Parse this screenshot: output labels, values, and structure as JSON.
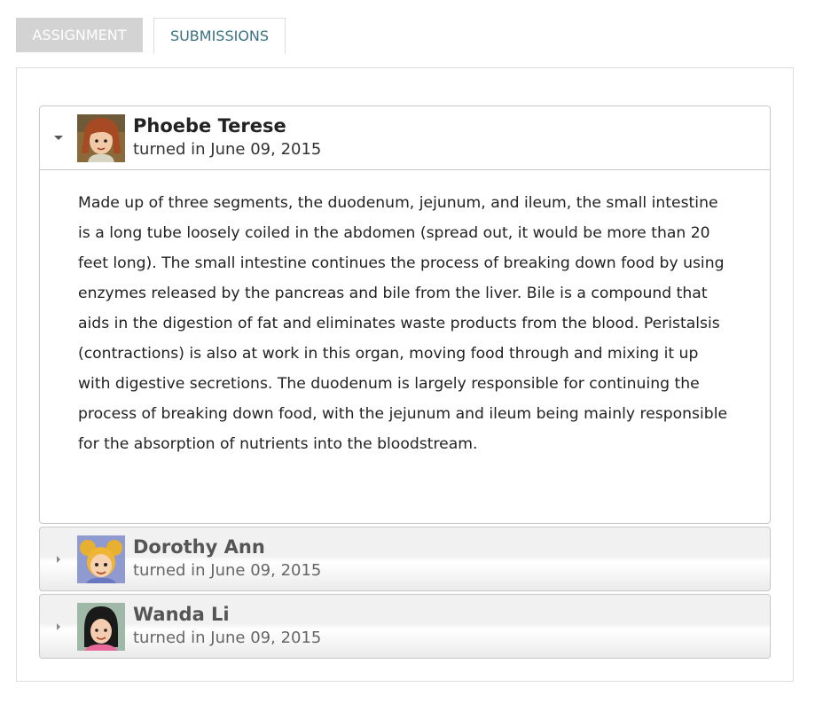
{
  "tabs": {
    "assignment": "ASSIGNMENT",
    "submissions": "SUBMISSIONS"
  },
  "submissions": [
    {
      "name": "Phoebe Terese",
      "meta": "turned in June 09, 2015",
      "expanded": true,
      "text": "Made up of three segments, the duodenum, jejunum, and ileum, the small intestine is a long tube loosely coiled in the abdomen (spread out, it would be more than 20 feet long). The small intestine continues the process of breaking down food by using enzymes released by the pancreas and bile from the liver. Bile is a compound that aids in the digestion of fat and eliminates waste products from the blood. Peristalsis (contractions) is also at work in this organ, moving food through and mixing it up with digestive secretions. The duodenum is largely responsible for continuing the process of breaking down food, with the jejunum and ileum being mainly responsible for the absorption of nutrients into the bloodstream."
    },
    {
      "name": "Dorothy Ann",
      "meta": "turned in June 09, 2015",
      "expanded": false
    },
    {
      "name": "Wanda Li",
      "meta": "turned in June 09, 2015",
      "expanded": false
    }
  ],
  "colors": {
    "tab_inactive_bg": "#d3d3d3",
    "tab_active_text": "#3a7184",
    "border": "#c8c8c8"
  }
}
